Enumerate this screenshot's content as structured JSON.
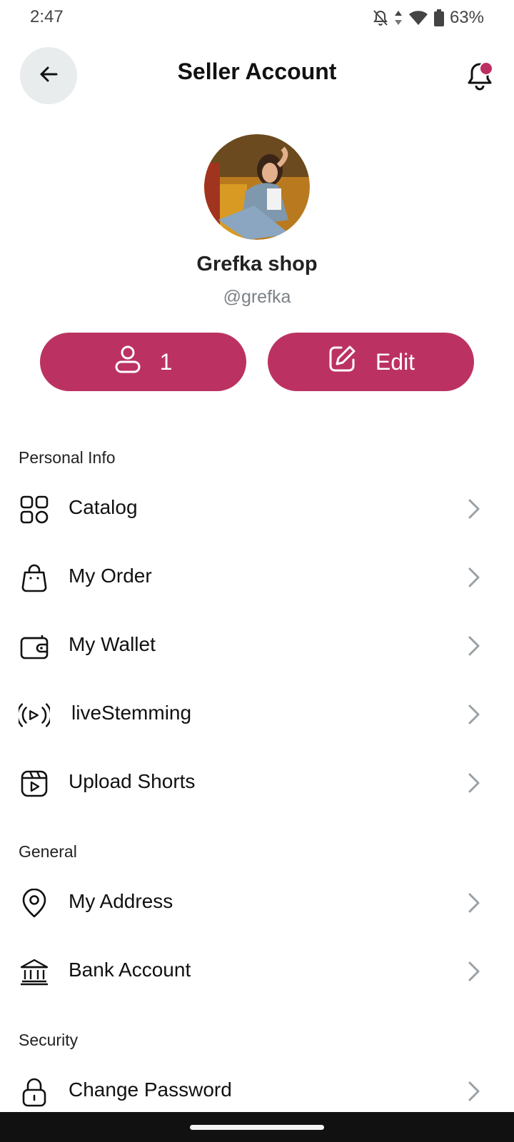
{
  "status_bar": {
    "time": "2:47",
    "battery": "63%",
    "icons": [
      "bell-off-icon",
      "data-arrows-icon",
      "wifi-icon",
      "battery-icon"
    ]
  },
  "header": {
    "title": "Seller Account",
    "back_icon": "arrow-left-icon",
    "bell_icon": "bell-icon"
  },
  "profile": {
    "shop_name": "Grefka shop",
    "username": "@grefka",
    "followers_count": "1",
    "edit_label": "Edit"
  },
  "sections": {
    "personal_info": "Personal Info",
    "general": "General",
    "security": "Security"
  },
  "personal_items": [
    {
      "label": "Catalog",
      "icon": "grid-icon"
    },
    {
      "label": "My Order",
      "icon": "shopping-bag-icon"
    },
    {
      "label": "My Wallet",
      "icon": "wallet-icon"
    },
    {
      "label": "liveStemming",
      "icon": "broadcast-icon"
    },
    {
      "label": "Upload Shorts",
      "icon": "reels-icon"
    }
  ],
  "general_items": [
    {
      "label": "My Address",
      "icon": "location-pin-icon"
    },
    {
      "label": "Bank Account",
      "icon": "bank-icon"
    }
  ],
  "security_items": [
    {
      "label": "Change Password",
      "icon": "lock-icon"
    }
  ],
  "colors": {
    "accent": "#bb3262",
    "back_button_bg": "#e9ecec",
    "muted_text": "#7b8287",
    "chevron": "#9aa0a4"
  }
}
